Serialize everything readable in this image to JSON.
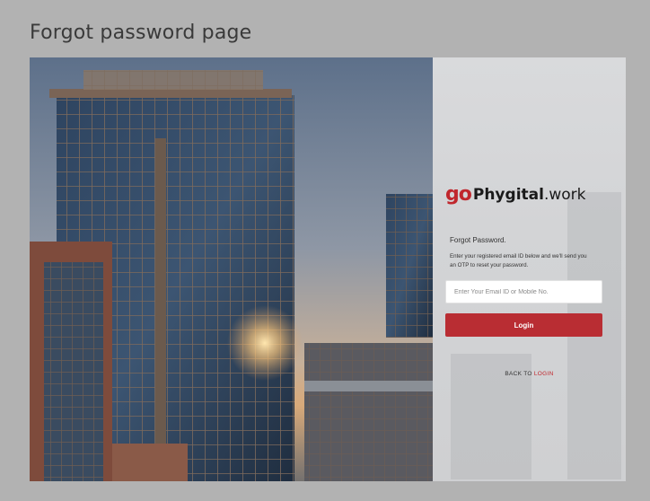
{
  "page": {
    "title": "Forgot password page"
  },
  "brand": {
    "mark": "go",
    "name_bold": "Phygital",
    "name_light": ".work",
    "accent": "#c0272d"
  },
  "form": {
    "heading": "Forgot Password.",
    "description": "Enter your registered email ID below and we'll send you an OTP to reset your password.",
    "email_placeholder": "Enter Your Email ID or Mobile No.",
    "submit_label": "Login",
    "back_prefix": "BACK TO",
    "back_link": "LOGIN"
  },
  "colors": {
    "primary_button": "#b92d33",
    "background": "#b2b2b2"
  },
  "image": {
    "alt": "city-skyline-photo"
  }
}
